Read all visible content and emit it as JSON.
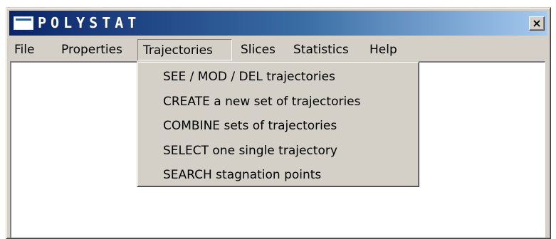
{
  "window": {
    "title": "POLYSTAT",
    "close_label": "×"
  },
  "menubar": {
    "items": [
      {
        "label": "File"
      },
      {
        "label": "Properties"
      },
      {
        "label": "Trajectories",
        "open": true
      },
      {
        "label": "Slices"
      },
      {
        "label": "Statistics"
      },
      {
        "label": "Help"
      }
    ]
  },
  "trajectories_menu": {
    "items": [
      {
        "label": "SEE / MOD / DEL trajectories"
      },
      {
        "label": "CREATE a new set of trajectories"
      },
      {
        "label": "COMBINE sets of trajectories"
      },
      {
        "label": "SELECT one single trajectory"
      },
      {
        "label": "SEARCH stagnation points"
      }
    ]
  },
  "colors": {
    "titlebar_start": "#0a246a",
    "titlebar_end": "#a6caf0",
    "face": "#d4d0c8",
    "client": "#ffffff"
  }
}
